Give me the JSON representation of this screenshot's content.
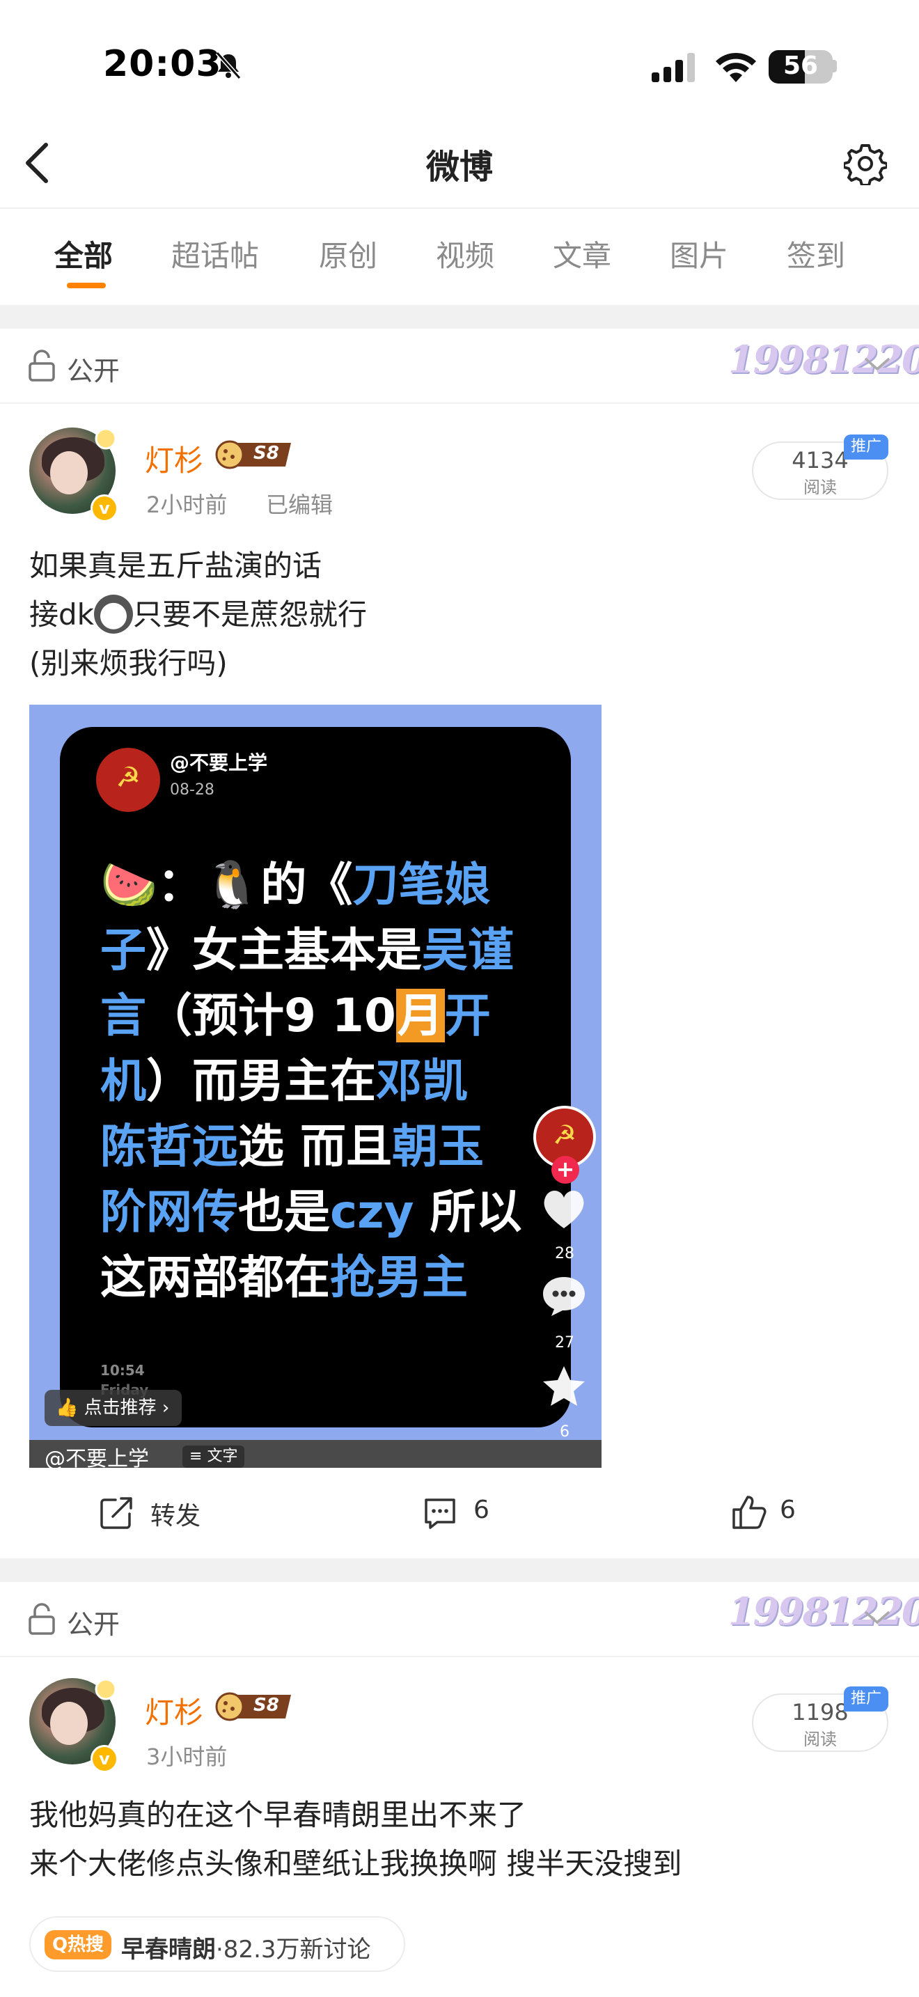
{
  "status_bar": {
    "time": "20:03",
    "battery": "56",
    "battery_level": 0.56
  },
  "nav": {
    "title": "微博"
  },
  "tabs": [
    {
      "label": "全部",
      "active": true
    },
    {
      "label": "超话帖"
    },
    {
      "label": "原创"
    },
    {
      "label": "视频"
    },
    {
      "label": "文章"
    },
    {
      "label": "图片"
    },
    {
      "label": "签到"
    }
  ],
  "colors": {
    "accent": "#ff8200",
    "author": "#f27000",
    "highlight_blue": "#5aa3f4",
    "promo": "#4b8ff2"
  },
  "posts": [
    {
      "visibility": "公开",
      "watermark": "19981220",
      "author": "灯杉",
      "level": "S8",
      "time": "2小时前",
      "edited": "已编辑",
      "reads": "4134",
      "reads_label": "阅读",
      "promo": "推广",
      "text_lines": [
        "如果真是五斤盐演的话",
        "接dk",
        "只要不是蔗怨就行",
        "(别来烦我行吗)"
      ],
      "media": {
        "handle": "@不要上学",
        "date": "08-28",
        "headline": {
          "l1a": "🍉：🐧的《",
          "l1b": "刀笔娘",
          "l2a": "子",
          "l2b": "》女主基本是",
          "l2c": "吴谨",
          "l3a": "言",
          "l3b": "（预计9 10",
          "l3c": "月",
          "l3d": "开",
          "l4a": "机",
          "l4b": "）而男主在",
          "l4c": "邓凯",
          "l5a": "陈哲远",
          "l5b": "选 而且",
          "l5c": "朝玉",
          "l6a": "阶网传",
          "l6b": "也是",
          "l6c": "czy",
          "l6d": " 所以",
          "l7a": "这两部都在",
          "l7b": "抢男主"
        },
        "clock": "10:54",
        "day": "Friday",
        "likes": "28",
        "comments": "27",
        "favorites": "6",
        "recommend": "点击推荐",
        "caption": "@不要上学",
        "type_chip": "文字"
      },
      "actions": {
        "repost": "转发",
        "comments": "6",
        "likes": "6"
      }
    },
    {
      "visibility": "公开",
      "watermark": "19981220",
      "author": "灯杉",
      "level": "S8",
      "time": "3小时前",
      "reads": "1198",
      "reads_label": "阅读",
      "promo": "推广",
      "text_lines": [
        "我他妈真的在这个早春晴朗里出不来了",
        "来个大佬修点头像和壁纸让我换换啊 搜半天没搜到"
      ],
      "hot_topic": {
        "badge": "热搜",
        "name": "早春晴朗",
        "stats": "·82.3万新讨论"
      }
    }
  ]
}
